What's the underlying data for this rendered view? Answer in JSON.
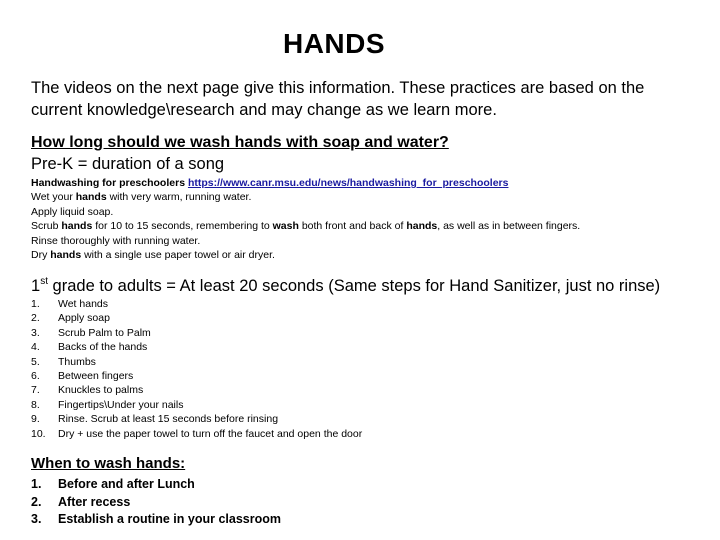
{
  "title": "HANDS",
  "intro": {
    "line1": "The videos on the next page give this information.  These practices are based on the",
    "line2": "current knowledge\\research and may change as we learn more."
  },
  "question": "How long should we wash hands with soap and water?",
  "prek": {
    "heading": "Pre-K = duration of a song",
    "source_label": "Handwashing for preschoolers ",
    "source_link": "https://www.canr.msu.edu/news/handwashing_for_preschoolers",
    "steps": [
      {
        "pre": "Wet your ",
        "bold": "hands",
        "post": " with very warm, running water."
      },
      {
        "pre": "Apply liquid soap.",
        "bold": "",
        "post": ""
      },
      {
        "pre": "Scrub ",
        "bold": "hands",
        "post": " for 10 to 15 seconds, remembering to ",
        "bold2": "wash",
        "post2": " both front and back of ",
        "bold3": "hands",
        "post3": ", as well as in between fingers."
      },
      {
        "pre": "Rinse thoroughly with running water.",
        "bold": "",
        "post": ""
      },
      {
        "pre": "Dry ",
        "bold": "hands",
        "post": " with a single use paper towel or air dryer."
      }
    ]
  },
  "grade": {
    "num": "1",
    "sup": "st",
    "text": " grade to adults = At least 20 seconds  (Same steps for Hand Sanitizer, just no rinse)",
    "steps": [
      {
        "num": "1.",
        "text": "Wet hands"
      },
      {
        "num": "2.",
        "text": "Apply soap"
      },
      {
        "num": "3.",
        "text": "Scrub Palm to Palm"
      },
      {
        "num": "4.",
        "text": "Backs of the hands"
      },
      {
        "num": "5.",
        "text": "Thumbs"
      },
      {
        "num": "6.",
        "text": "Between fingers"
      },
      {
        "num": "7.",
        "text": "Knuckles to palms"
      },
      {
        "num": "8.",
        "text": "Fingertips\\Under your nails"
      },
      {
        "num": "9.",
        "text": "Rinse.  Scrub at least 15 seconds before rinsing"
      },
      {
        "num": "10.",
        "text": "Dry + use the paper towel to turn off the faucet and open the door"
      }
    ]
  },
  "when": {
    "heading": "When to wash hands:",
    "items": [
      {
        "num": "1.",
        "text": "Before and after Lunch"
      },
      {
        "num": "2.",
        "text": "After recess"
      },
      {
        "num": "3.",
        "text": "Establish a routine in your classroom"
      }
    ]
  },
  "colors": {
    "link": "#1a1aa0",
    "text": "#000000"
  }
}
